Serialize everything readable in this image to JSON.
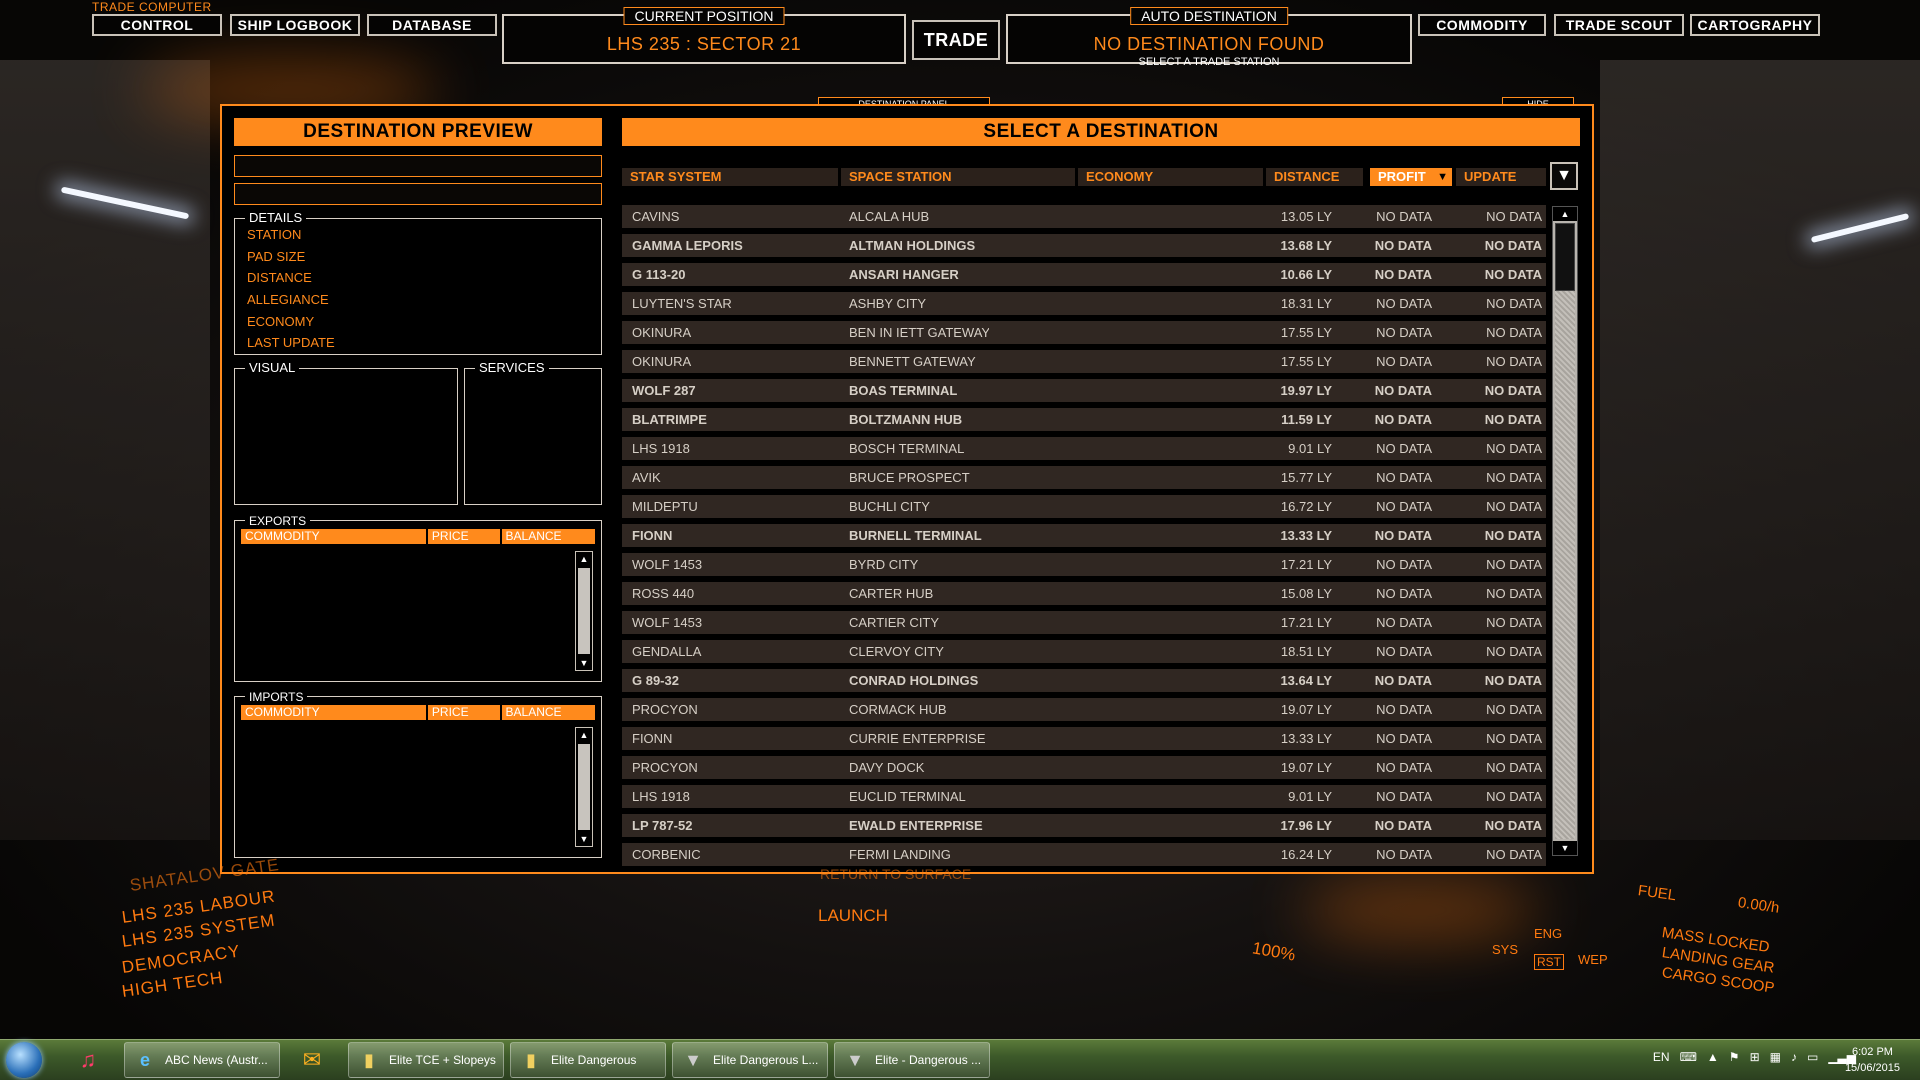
{
  "header": {
    "app_label": "TRADE COMPUTER",
    "nav_left": [
      "CONTROL",
      "SHIP LOGBOOK",
      "DATABASE"
    ],
    "current_position": {
      "caption": "CURRENT POSITION",
      "value": "LHS 235 : SECTOR 21"
    },
    "trade_button": "TRADE",
    "auto_destination": {
      "caption": "AUTO DESTINATION",
      "value": "NO DESTINATION FOUND",
      "hint": "SELECT A TRADE STATION"
    },
    "nav_right": [
      "COMMODITY",
      "TRADE SCOUT",
      "CARTOGRAPHY"
    ]
  },
  "panel": {
    "tab_label": "DESTINATION PANEL",
    "hide_label": "HIDE",
    "preview": {
      "title": "DESTINATION PREVIEW",
      "details_title": "DETAILS",
      "details": [
        "STATION",
        "PAD SIZE",
        "DISTANCE",
        "ALLEGIANCE",
        "ECONOMY",
        "LAST UPDATE"
      ],
      "visual_title": "VISUAL",
      "services_title": "SERVICES",
      "exports_title": "EXPORTS",
      "imports_title": "IMPORTS",
      "market_columns": [
        "COMMODITY",
        "PRICE",
        "BALANCE"
      ]
    },
    "destinations": {
      "title": "SELECT A DESTINATION",
      "columns": [
        "STAR SYSTEM",
        "SPACE STATION",
        "ECONOMY",
        "DISTANCE",
        "PROFIT",
        "UPDATE"
      ],
      "sort_arrow": "▼",
      "rows": [
        {
          "system": "CAVINS",
          "station": "ALCALA HUB",
          "distance": "13.05 LY",
          "profit": "NO DATA",
          "update": "NO DATA",
          "bold": false
        },
        {
          "system": "GAMMA LEPORIS",
          "station": "ALTMAN HOLDINGS",
          "distance": "13.68 LY",
          "profit": "NO DATA",
          "update": "NO DATA",
          "bold": true
        },
        {
          "system": "G 113-20",
          "station": "ANSARI HANGER",
          "distance": "10.66 LY",
          "profit": "NO DATA",
          "update": "NO DATA",
          "bold": true
        },
        {
          "system": "LUYTEN'S STAR",
          "station": "ASHBY CITY",
          "distance": "18.31 LY",
          "profit": "NO DATA",
          "update": "NO DATA",
          "bold": false
        },
        {
          "system": "OKINURA",
          "station": "BEN IN IETT GATEWAY",
          "distance": "17.55 LY",
          "profit": "NO DATA",
          "update": "NO DATA",
          "bold": false
        },
        {
          "system": "OKINURA",
          "station": "BENNETT GATEWAY",
          "distance": "17.55 LY",
          "profit": "NO DATA",
          "update": "NO DATA",
          "bold": false
        },
        {
          "system": "WOLF 287",
          "station": "BOAS TERMINAL",
          "distance": "19.97 LY",
          "profit": "NO DATA",
          "update": "NO DATA",
          "bold": true
        },
        {
          "system": "BLATRIMPE",
          "station": "BOLTZMANN HUB",
          "distance": "11.59 LY",
          "profit": "NO DATA",
          "update": "NO DATA",
          "bold": true
        },
        {
          "system": "LHS 1918",
          "station": "BOSCH TERMINAL",
          "distance": "9.01 LY",
          "profit": "NO DATA",
          "update": "NO DATA",
          "bold": false
        },
        {
          "system": "AVIK",
          "station": "BRUCE PROSPECT",
          "distance": "15.77 LY",
          "profit": "NO DATA",
          "update": "NO DATA",
          "bold": false
        },
        {
          "system": "MILDEPTU",
          "station": "BUCHLI CITY",
          "distance": "16.72 LY",
          "profit": "NO DATA",
          "update": "NO DATA",
          "bold": false
        },
        {
          "system": "FIONN",
          "station": "BURNELL TERMINAL",
          "distance": "13.33 LY",
          "profit": "NO DATA",
          "update": "NO DATA",
          "bold": true
        },
        {
          "system": "WOLF 1453",
          "station": "BYRD CITY",
          "distance": "17.21 LY",
          "profit": "NO DATA",
          "update": "NO DATA",
          "bold": false
        },
        {
          "system": "ROSS 440",
          "station": "CARTER HUB",
          "distance": "15.08 LY",
          "profit": "NO DATA",
          "update": "NO DATA",
          "bold": false
        },
        {
          "system": "WOLF 1453",
          "station": "CARTIER CITY",
          "distance": "17.21 LY",
          "profit": "NO DATA",
          "update": "NO DATA",
          "bold": false
        },
        {
          "system": "GENDALLA",
          "station": "CLERVOY CITY",
          "distance": "18.51 LY",
          "profit": "NO DATA",
          "update": "NO DATA",
          "bold": false
        },
        {
          "system": "G 89-32",
          "station": "CONRAD HOLDINGS",
          "distance": "13.64 LY",
          "profit": "NO DATA",
          "update": "NO DATA",
          "bold": true
        },
        {
          "system": "PROCYON",
          "station": "CORMACK HUB",
          "distance": "19.07 LY",
          "profit": "NO DATA",
          "update": "NO DATA",
          "bold": false
        },
        {
          "system": "FIONN",
          "station": "CURRIE ENTERPRISE",
          "distance": "13.33 LY",
          "profit": "NO DATA",
          "update": "NO DATA",
          "bold": false
        },
        {
          "system": "PROCYON",
          "station": "DAVY DOCK",
          "distance": "19.07 LY",
          "profit": "NO DATA",
          "update": "NO DATA",
          "bold": false
        },
        {
          "system": "LHS 1918",
          "station": "EUCLID TERMINAL",
          "distance": "9.01 LY",
          "profit": "NO DATA",
          "update": "NO DATA",
          "bold": false
        },
        {
          "system": "LP 787-52",
          "station": "EWALD ENTERPRISE",
          "distance": "17.96 LY",
          "profit": "NO DATA",
          "update": "NO DATA",
          "bold": true
        },
        {
          "system": "CORBENIC",
          "station": "FERMI LANDING",
          "distance": "16.24 LY",
          "profit": "NO DATA",
          "update": "NO DATA",
          "bold": false
        }
      ]
    }
  },
  "cockpit": {
    "left_hud": [
      "SHATALOV GATE",
      "LHS 235 LABOUR",
      "LHS 235 SYSTEM",
      "DEMOCRACY",
      "HIGH TECH"
    ],
    "launch": "LAUNCH",
    "return": "RETURN TO SURFACE",
    "throttle": "100%",
    "pips": [
      "SYS",
      "ENG",
      "WEP",
      "RST"
    ],
    "fuel_label": "FUEL",
    "fuel_value": "0.00/h",
    "status": [
      "MASS LOCKED",
      "LANDING GEAR",
      "CARGO SCOOP"
    ]
  },
  "taskbar": {
    "items": [
      {
        "label": "ABC News (Austr...",
        "icon": "ie-icon"
      },
      {
        "label": "Elite TCE + Slopeys",
        "icon": "folder-icon"
      },
      {
        "label": "Elite Dangerous",
        "icon": "folder-icon"
      },
      {
        "label": "Elite Dangerous L...",
        "icon": "elite-icon"
      },
      {
        "label": "Elite - Dangerous ...",
        "icon": "elite-icon"
      }
    ],
    "lang": "EN",
    "time": "6:02 PM",
    "date": "15/06/2015"
  }
}
